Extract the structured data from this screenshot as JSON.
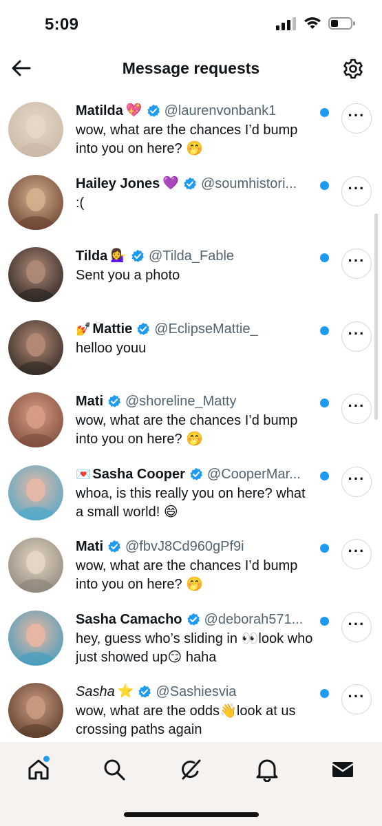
{
  "status_bar": {
    "time": "5:09"
  },
  "header": {
    "title": "Message requests"
  },
  "colors": {
    "accent": "#1d9bf0",
    "text": "#0f1419",
    "muted": "#536471"
  },
  "requests": [
    {
      "name": "Matilda",
      "name_emoji": "💖",
      "handle": "@laurenvonbank1",
      "message": "wow, what are the chances I’d bump into you on here? 🤭",
      "avatar_colors": [
        "#c9b8a6",
        "#e7d8c7"
      ]
    },
    {
      "name": "Hailey Jones",
      "name_emoji": "💜",
      "handle": "@soumhistori...",
      "message": ":(",
      "avatar_colors": [
        "#6a4030",
        "#d4b08c"
      ]
    },
    {
      "name": "Tilda",
      "name_emoji": "💁‍♀️",
      "handle": "@Tilda_Fable",
      "message": "Sent you a photo",
      "avatar_colors": [
        "#2a2320",
        "#b08a78"
      ]
    },
    {
      "name": "Mattie",
      "name_prefix_emoji": "💅",
      "handle": "@EclipseMattie_",
      "message": "helloo youu",
      "avatar_colors": [
        "#2e2622",
        "#b58b77"
      ]
    },
    {
      "name": "Mati",
      "handle": "@shoreline_Matty",
      "message": "wow, what are the chances I’d bump into you on here? 🤭",
      "avatar_colors": [
        "#7b4b3a",
        "#d79c84"
      ]
    },
    {
      "name": "Sasha Cooper",
      "name_prefix_emoji": "💌",
      "handle": "@CooperMar...",
      "message": "whoa, is this really you on here? what a small world! 😄",
      "avatar_colors": [
        "#4aa8c9",
        "#e7b8a6"
      ]
    },
    {
      "name": "Mati",
      "handle": "@fbvJ8Cd960gPf9i",
      "message": "wow, what are the chances I’d bump into you on here? 🤭",
      "avatar_colors": [
        "#8c8479",
        "#e5d6c5"
      ]
    },
    {
      "name": "Sasha Camacho",
      "handle": "@deborah571...",
      "message": "hey, guess who’s sliding in 👀look who just showed up😏 haha",
      "avatar_colors": [
        "#3e9dc0",
        "#e8b7a2"
      ]
    },
    {
      "name": "Sasha",
      "name_italic": true,
      "name_emoji": "⭐",
      "handle": "@Sashiesvia",
      "message": "wow, what are the odds👋look at us crossing paths again",
      "avatar_colors": [
        "#5a3a2a",
        "#c99a80"
      ]
    }
  ],
  "tabs": [
    {
      "name": "home",
      "icon": "home-icon"
    },
    {
      "name": "search",
      "icon": "search-icon"
    },
    {
      "name": "grok",
      "icon": "grok-icon"
    },
    {
      "name": "notifications",
      "icon": "bell-icon"
    },
    {
      "name": "messages",
      "icon": "mail-icon"
    }
  ]
}
